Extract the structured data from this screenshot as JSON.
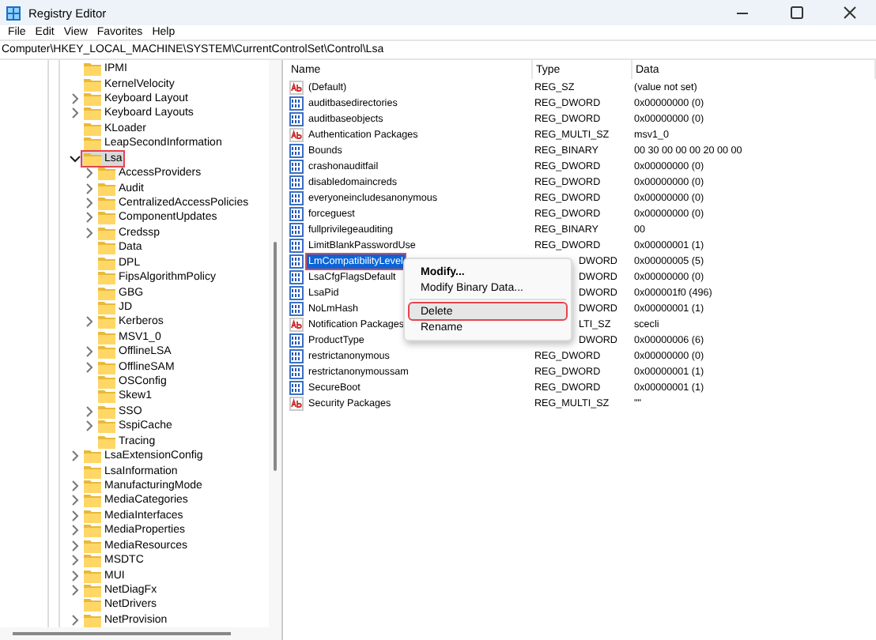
{
  "window": {
    "title": "Registry Editor"
  },
  "menu": [
    "File",
    "Edit",
    "View",
    "Favorites",
    "Help"
  ],
  "address": "Computer\\HKEY_LOCAL_MACHINE\\SYSTEM\\CurrentControlSet\\Control\\Lsa",
  "tree": [
    {
      "name": "IPMI",
      "has_children": false,
      "selected": false
    },
    {
      "name": "KernelVelocity",
      "has_children": false,
      "selected": false
    },
    {
      "name": "Keyboard Layout",
      "has_children": true,
      "selected": false
    },
    {
      "name": "Keyboard Layouts",
      "has_children": true,
      "selected": false
    },
    {
      "name": "KLoader",
      "has_children": false,
      "selected": false
    },
    {
      "name": "LeapSecondInformation",
      "has_children": false,
      "selected": false
    },
    {
      "name": "Lsa",
      "has_children": true,
      "expanded": true,
      "selected": true,
      "children": [
        {
          "name": "AccessProviders",
          "has_children": true,
          "selected": false
        },
        {
          "name": "Audit",
          "has_children": true,
          "selected": false
        },
        {
          "name": "CentralizedAccessPolicies",
          "has_children": true,
          "selected": false
        },
        {
          "name": "ComponentUpdates",
          "has_children": true,
          "selected": false
        },
        {
          "name": "Credssp",
          "has_children": true,
          "selected": false
        },
        {
          "name": "Data",
          "has_children": false,
          "selected": false
        },
        {
          "name": "DPL",
          "has_children": false,
          "selected": false
        },
        {
          "name": "FipsAlgorithmPolicy",
          "has_children": false,
          "selected": false
        },
        {
          "name": "GBG",
          "has_children": false,
          "selected": false
        },
        {
          "name": "JD",
          "has_children": false,
          "selected": false
        },
        {
          "name": "Kerberos",
          "has_children": true,
          "selected": false
        },
        {
          "name": "MSV1_0",
          "has_children": false,
          "selected": false
        },
        {
          "name": "OfflineLSA",
          "has_children": true,
          "selected": false
        },
        {
          "name": "OfflineSAM",
          "has_children": true,
          "selected": false
        },
        {
          "name": "OSConfig",
          "has_children": false,
          "selected": false
        },
        {
          "name": "Skew1",
          "has_children": false,
          "selected": false
        },
        {
          "name": "SSO",
          "has_children": true,
          "selected": false
        },
        {
          "name": "SspiCache",
          "has_children": true,
          "selected": false
        },
        {
          "name": "Tracing",
          "has_children": false,
          "selected": false
        }
      ]
    },
    {
      "name": "LsaExtensionConfig",
      "has_children": true,
      "selected": false
    },
    {
      "name": "LsaInformation",
      "has_children": false,
      "selected": false
    },
    {
      "name": "ManufacturingMode",
      "has_children": true,
      "selected": false
    },
    {
      "name": "MediaCategories",
      "has_children": true,
      "selected": false
    },
    {
      "name": "MediaInterfaces",
      "has_children": true,
      "selected": false
    },
    {
      "name": "MediaProperties",
      "has_children": true,
      "selected": false
    },
    {
      "name": "MediaResources",
      "has_children": true,
      "selected": false
    },
    {
      "name": "MSDTC",
      "has_children": true,
      "selected": false
    },
    {
      "name": "MUI",
      "has_children": true,
      "selected": false
    },
    {
      "name": "NetDiagFx",
      "has_children": true,
      "selected": false
    },
    {
      "name": "NetDrivers",
      "has_children": false,
      "selected": false
    },
    {
      "name": "NetProvision",
      "has_children": true,
      "selected": false
    }
  ],
  "values": {
    "columns": [
      "Name",
      "Type",
      "Data"
    ],
    "rows": [
      {
        "kind": "string",
        "name": "(Default)",
        "type": "REG_SZ",
        "data": "(value not set)",
        "selected": false,
        "type_covered": false
      },
      {
        "kind": "binary",
        "name": "auditbasedirectories",
        "type": "REG_DWORD",
        "data": "0x00000000 (0)",
        "selected": false,
        "type_covered": false
      },
      {
        "kind": "binary",
        "name": "auditbaseobjects",
        "type": "REG_DWORD",
        "data": "0x00000000 (0)",
        "selected": false,
        "type_covered": false
      },
      {
        "kind": "string",
        "name": "Authentication Packages",
        "type": "REG_MULTI_SZ",
        "data": "msv1_0",
        "selected": false,
        "type_covered": false
      },
      {
        "kind": "binary",
        "name": "Bounds",
        "type": "REG_BINARY",
        "data": "00 30 00 00 00 20 00 00",
        "selected": false,
        "type_covered": false
      },
      {
        "kind": "binary",
        "name": "crashonauditfail",
        "type": "REG_DWORD",
        "data": "0x00000000 (0)",
        "selected": false,
        "type_covered": false
      },
      {
        "kind": "binary",
        "name": "disabledomaincreds",
        "type": "REG_DWORD",
        "data": "0x00000000 (0)",
        "selected": false,
        "type_covered": false
      },
      {
        "kind": "binary",
        "name": "everyoneincludesanonymous",
        "type": "REG_DWORD",
        "data": "0x00000000 (0)",
        "selected": false,
        "type_covered": false
      },
      {
        "kind": "binary",
        "name": "forceguest",
        "type": "REG_DWORD",
        "data": "0x00000000 (0)",
        "selected": false,
        "type_covered": false
      },
      {
        "kind": "binary",
        "name": "fullprivilegeauditing",
        "type": "REG_BINARY",
        "data": "00",
        "selected": false,
        "type_covered": false
      },
      {
        "kind": "binary",
        "name": "LimitBlankPasswordUse",
        "type": "REG_DWORD",
        "data": "0x00000001 (1)",
        "selected": false,
        "type_covered": false
      },
      {
        "kind": "binary",
        "name": "LmCompatibilityLevel",
        "type": "DWORD",
        "data": "0x00000005 (5)",
        "selected": true,
        "type_covered": true
      },
      {
        "kind": "binary",
        "name": "LsaCfgFlagsDefault",
        "type": "DWORD",
        "data": "0x00000000 (0)",
        "selected": false,
        "type_covered": true
      },
      {
        "kind": "binary",
        "name": "LsaPid",
        "type": "DWORD",
        "data": "0x000001f0 (496)",
        "selected": false,
        "type_covered": true
      },
      {
        "kind": "binary",
        "name": "NoLmHash",
        "type": "DWORD",
        "data": "0x00000001 (1)",
        "selected": false,
        "type_covered": true
      },
      {
        "kind": "string",
        "name": "Notification Packages",
        "type": "LTI_SZ",
        "data": "scecli",
        "selected": false,
        "type_covered": true
      },
      {
        "kind": "binary",
        "name": "ProductType",
        "type": "DWORD",
        "data": "0x00000006 (6)",
        "selected": false,
        "type_covered": true
      },
      {
        "kind": "binary",
        "name": "restrictanonymous",
        "type": "REG_DWORD",
        "data": "0x00000000 (0)",
        "selected": false,
        "type_covered": false
      },
      {
        "kind": "binary",
        "name": "restrictanonymoussam",
        "type": "REG_DWORD",
        "data": "0x00000001 (1)",
        "selected": false,
        "type_covered": false
      },
      {
        "kind": "binary",
        "name": "SecureBoot",
        "type": "REG_DWORD",
        "data": "0x00000001 (1)",
        "selected": false,
        "type_covered": false
      },
      {
        "kind": "string",
        "name": "Security Packages",
        "type": "REG_MULTI_SZ",
        "data": "\"\"",
        "selected": false,
        "type_covered": false
      }
    ]
  },
  "context_menu": [
    {
      "kind": "item",
      "label": "Modify...",
      "highlighted": false,
      "bold": true
    },
    {
      "kind": "item",
      "label": "Modify Binary Data...",
      "highlighted": false,
      "bold": false
    },
    {
      "kind": "separator"
    },
    {
      "kind": "item",
      "label": "Delete",
      "highlighted": true,
      "bold": false
    },
    {
      "kind": "item",
      "label": "Rename",
      "highlighted": false,
      "bold": false
    }
  ]
}
